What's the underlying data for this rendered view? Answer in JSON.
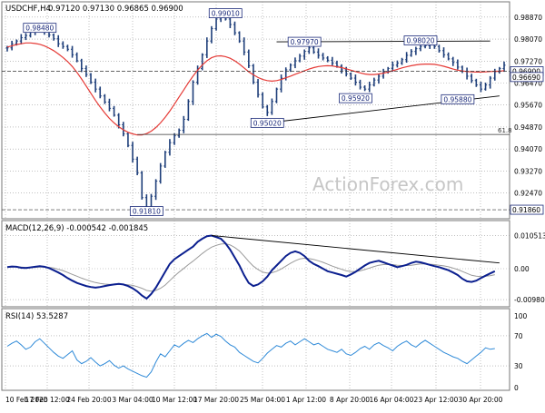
{
  "header": {
    "symbol_tf": "USDCHF,H4",
    "ohlc": "0.97120 0.97130 0.96865 0.96900"
  },
  "watermark": "ActionForex.com",
  "colors": {
    "bar": "#1f3f7a",
    "ma": "#e53935",
    "macd_main": "#0b1f8f",
    "macd_signal": "#9a9a9a",
    "rsi": "#2f8ad8",
    "grid": "#9a9a9a",
    "trend": "#000000",
    "ref_hline": "#333333"
  },
  "chart_data": [
    {
      "type": "line",
      "panel": "price",
      "title": "USDCHF,H4",
      "ylim": [
        0.9163,
        0.9903
      ],
      "y_ticks": [
        "0.98870",
        "0.98070",
        "0.97270",
        "0.96470",
        "0.95670",
        "0.94870",
        "0.94070",
        "0.93270",
        "0.92470"
      ],
      "x_ticks": [
        "10 Feb 2020",
        "17 Feb 12:00",
        "24 Feb 20:00",
        "3 Mar 04:00",
        "10 Mar 12:00",
        "17 Mar 20:00",
        "25 Mar 04:00",
        "1 Apr 12:00",
        "8 Apr 20:00",
        "16 Apr 04:00",
        "23 Apr 12:00",
        "30 Apr 20:00"
      ],
      "series": [
        {
          "values": [
            0.9775,
            0.979,
            0.98,
            0.9812,
            0.982,
            0.9832,
            0.9841,
            0.9845,
            0.9836,
            0.9822,
            0.9808,
            0.979,
            0.978,
            0.977,
            0.975,
            0.9728,
            0.97,
            0.9678,
            0.965,
            0.9625,
            0.96,
            0.9578,
            0.9555,
            0.953,
            0.9495,
            0.9462,
            0.942,
            0.937,
            0.932,
            0.923,
            0.9185,
            0.9235,
            0.929,
            0.9345,
            0.9395,
            0.943,
            0.9455,
            0.9475,
            0.9515,
            0.958,
            0.965,
            0.97,
            0.975,
            0.98,
            0.9845,
            0.988,
            0.9895,
            0.988,
            0.986,
            0.983,
            0.98,
            0.976,
            0.971,
            0.965,
            0.9605,
            0.956,
            0.954,
            0.958,
            0.9625,
            0.9665,
            0.9695,
            0.9712,
            0.9728,
            0.9745,
            0.9762,
            0.9775,
            0.976,
            0.9748,
            0.9738,
            0.973,
            0.972,
            0.9708,
            0.9695,
            0.968,
            0.9665,
            0.965,
            0.9632,
            0.9625,
            0.964,
            0.9658,
            0.9672,
            0.9688,
            0.97,
            0.9712,
            0.972,
            0.9732,
            0.9748,
            0.9762,
            0.9772,
            0.978,
            0.9783,
            0.9785,
            0.978,
            0.9765,
            0.975,
            0.9735,
            0.9722,
            0.9705,
            0.969,
            0.9672,
            0.9656,
            0.964,
            0.9625,
            0.964,
            0.9665,
            0.9688,
            0.97,
            0.9712
          ]
        }
      ],
      "ma": [
        0.9778,
        0.9782,
        0.9787,
        0.979,
        0.9793,
        0.9793,
        0.9791,
        0.9788,
        0.9782,
        0.9774,
        0.9765,
        0.9753,
        0.974,
        0.9725,
        0.9707,
        0.9686,
        0.9662,
        0.9636,
        0.961,
        0.9584,
        0.956,
        0.9538,
        0.9518,
        0.9502,
        0.9488,
        0.9477,
        0.9468,
        0.9462,
        0.9458,
        0.9458,
        0.9463,
        0.9472,
        0.9485,
        0.9502,
        0.9522,
        0.9545,
        0.957,
        0.9596,
        0.9622,
        0.9648,
        0.9672,
        0.9694,
        0.9713,
        0.9728,
        0.9739,
        0.9745,
        0.9746,
        0.9743,
        0.9737,
        0.9728,
        0.9716,
        0.9702,
        0.9688,
        0.9677,
        0.9667,
        0.966,
        0.9656,
        0.9654,
        0.9656,
        0.966,
        0.9666,
        0.9672,
        0.9679,
        0.9685,
        0.9692,
        0.9698,
        0.9703,
        0.9707,
        0.9709,
        0.971,
        0.9709,
        0.9706,
        0.9703,
        0.9699,
        0.9694,
        0.9689,
        0.9684,
        0.968,
        0.9678,
        0.9678,
        0.968,
        0.9683,
        0.9687,
        0.9692,
        0.9697,
        0.9702,
        0.9706,
        0.971,
        0.9713,
        0.9715,
        0.9716,
        0.9716,
        0.9715,
        0.9712,
        0.9708,
        0.9703,
        0.9698,
        0.9694,
        0.9691,
        0.9689,
        0.9688,
        0.9687,
        0.9687,
        0.9688,
        0.9689,
        0.969,
        0.969,
        0.9692
      ],
      "price_flags": [
        {
          "text": "0.98480",
          "value": 0.9848,
          "at": 7
        },
        {
          "text": "0.99010",
          "value": 0.9901,
          "at": 47
        },
        {
          "text": "0.97970",
          "value": 0.9797,
          "at": 64
        },
        {
          "text": "0.98020",
          "value": 0.9802,
          "at": 89
        },
        {
          "text": "0.95920",
          "value": 0.9592,
          "at": 75
        },
        {
          "text": "0.95880",
          "value": 0.9588,
          "at": 97
        },
        {
          "text": "0.95020",
          "value": 0.9502,
          "at": 56
        },
        {
          "text": "0.91810",
          "value": 0.9181,
          "at": 30
        }
      ],
      "axis_flags": [
        {
          "text": "0.96900",
          "value": 0.969
        },
        {
          "text": "0.96690",
          "value": 0.9669
        },
        {
          "text": "0.91860",
          "value": 0.9186
        }
      ],
      "fib_level": {
        "text": "61.8",
        "value": 0.946
      },
      "ref_levels": [
        0.969,
        0.9186
      ],
      "trendlines": [
        {
          "from": {
            "at": 58,
            "value": 0.9797
          },
          "to": {
            "at": 104,
            "value": 0.98
          }
        },
        {
          "from": {
            "at": 56,
            "value": 0.9502
          },
          "to": {
            "at": 106,
            "value": 0.96
          }
        }
      ]
    },
    {
      "type": "line",
      "panel": "macd",
      "title": "MACD(12,26,9) -0.000542 -0.001845",
      "ylim": [
        -0.0115,
        0.0115
      ],
      "y_ticks": [
        "0.010513",
        "0.00",
        "-0.009804"
      ],
      "series": [
        {
          "name": "MACD",
          "values": [
            0.0005,
            0.0007,
            0.0006,
            0.0003,
            0.0002,
            0.0004,
            0.0006,
            0.0008,
            0.0006,
            0.0002,
            -0.0005,
            -0.0012,
            -0.002,
            -0.003,
            -0.0038,
            -0.0045,
            -0.005,
            -0.0055,
            -0.0058,
            -0.006,
            -0.0058,
            -0.0055,
            -0.0052,
            -0.005,
            -0.0048,
            -0.005,
            -0.0055,
            -0.0062,
            -0.0072,
            -0.0085,
            -0.0095,
            -0.008,
            -0.006,
            -0.0035,
            -0.001,
            0.0015,
            0.003,
            0.004,
            0.005,
            0.006,
            0.007,
            0.0085,
            0.0095,
            0.0103,
            0.0105,
            0.01,
            0.0095,
            0.008,
            0.006,
            0.0035,
            0.001,
            -0.002,
            -0.0045,
            -0.0055,
            -0.005,
            -0.004,
            -0.0025,
            -0.0005,
            0.001,
            0.0025,
            0.004,
            0.005,
            0.0055,
            0.005,
            0.004,
            0.0025,
            0.0015,
            0.0008,
            0.0,
            -0.0008,
            -0.0012,
            -0.0016,
            -0.002,
            -0.0025,
            -0.0018,
            -0.001,
            0.0,
            0.001,
            0.0018,
            0.0022,
            0.0025,
            0.002,
            0.0015,
            0.001,
            0.0005,
            0.0008,
            0.0012,
            0.0018,
            0.0022,
            0.002,
            0.0016,
            0.0012,
            0.0008,
            0.0005,
            0.0,
            -0.0005,
            -0.0012,
            -0.002,
            -0.0032,
            -0.004,
            -0.0042,
            -0.0038,
            -0.003,
            -0.0022,
            -0.0015,
            -0.0008
          ]
        },
        {
          "name": "Signal",
          "values": [
            0.0005,
            0.0005,
            0.0006,
            0.0005,
            0.0004,
            0.0004,
            0.0004,
            0.0005,
            0.0005,
            0.0004,
            0.0002,
            -0.0002,
            -0.0006,
            -0.0012,
            -0.0018,
            -0.0024,
            -0.003,
            -0.0035,
            -0.004,
            -0.0044,
            -0.0047,
            -0.0049,
            -0.005,
            -0.005,
            -0.005,
            -0.005,
            -0.0051,
            -0.0053,
            -0.0057,
            -0.0062,
            -0.0069,
            -0.0071,
            -0.0069,
            -0.0062,
            -0.0052,
            -0.0038,
            -0.0024,
            -0.0011,
            0.0001,
            0.0013,
            0.0024,
            0.0036,
            0.0048,
            0.0059,
            0.0068,
            0.0074,
            0.0078,
            0.0079,
            0.0075,
            0.0067,
            0.0056,
            0.004,
            0.0023,
            0.0008,
            -0.0003,
            -0.0011,
            -0.0014,
            -0.0013,
            -0.0008,
            -0.0001,
            0.0008,
            0.0017,
            0.0025,
            0.0031,
            0.0033,
            0.0032,
            0.0029,
            0.0025,
            0.002,
            0.0014,
            0.0008,
            0.0003,
            -0.0002,
            -0.0007,
            -0.0009,
            -0.0009,
            -0.0007,
            -0.0003,
            0.0002,
            0.0007,
            0.0011,
            0.0013,
            0.0013,
            0.0013,
            0.0011,
            0.001,
            0.001,
            0.0011,
            0.0013,
            0.0015,
            0.0015,
            0.0014,
            0.0013,
            0.0011,
            0.0009,
            0.0006,
            0.0002,
            -0.0003,
            -0.0009,
            -0.0015,
            -0.0021,
            -0.0024,
            -0.0025,
            -0.0024,
            -0.0022,
            -0.0019
          ]
        }
      ],
      "trendline": {
        "from": {
          "at": 44,
          "value": 0.0105
        },
        "to": {
          "at": 106,
          "value": 0.0018
        }
      }
    },
    {
      "type": "line",
      "panel": "rsi",
      "title": "RSI(14) 53.5287",
      "ylim": [
        0,
        100
      ],
      "y_ticks": [
        "100",
        "70",
        "30",
        "0"
      ],
      "levels": [
        70,
        30
      ],
      "series": [
        {
          "name": "RSI(14)",
          "values": [
            56,
            60,
            63,
            58,
            52,
            55,
            62,
            66,
            60,
            54,
            48,
            43,
            40,
            45,
            50,
            38,
            33,
            36,
            41,
            35,
            30,
            33,
            37,
            31,
            27,
            30,
            26,
            23,
            20,
            17,
            15,
            22,
            35,
            46,
            42,
            50,
            58,
            55,
            60,
            64,
            61,
            66,
            70,
            73,
            68,
            72,
            69,
            63,
            58,
            55,
            48,
            44,
            40,
            36,
            34,
            40,
            47,
            52,
            57,
            55,
            60,
            63,
            58,
            62,
            66,
            62,
            58,
            60,
            56,
            52,
            50,
            48,
            52,
            46,
            44,
            48,
            53,
            56,
            52,
            58,
            61,
            57,
            54,
            50,
            56,
            60,
            63,
            58,
            55,
            60,
            64,
            60,
            56,
            52,
            48,
            45,
            42,
            40,
            36,
            33,
            38,
            43,
            48,
            54,
            52,
            53
          ]
        }
      ],
      "x_ticks": [
        "10 Feb 2020",
        "17 Feb 12:00",
        "24 Feb 20:00",
        "3 Mar 04:00",
        "10 Mar 12:00",
        "17 Mar 20:00",
        "25 Mar 04:00",
        "1 Apr 12:00",
        "8 Apr 20:00",
        "16 Apr 04:00",
        "23 Apr 12:00",
        "30 Apr 20:00"
      ]
    }
  ]
}
